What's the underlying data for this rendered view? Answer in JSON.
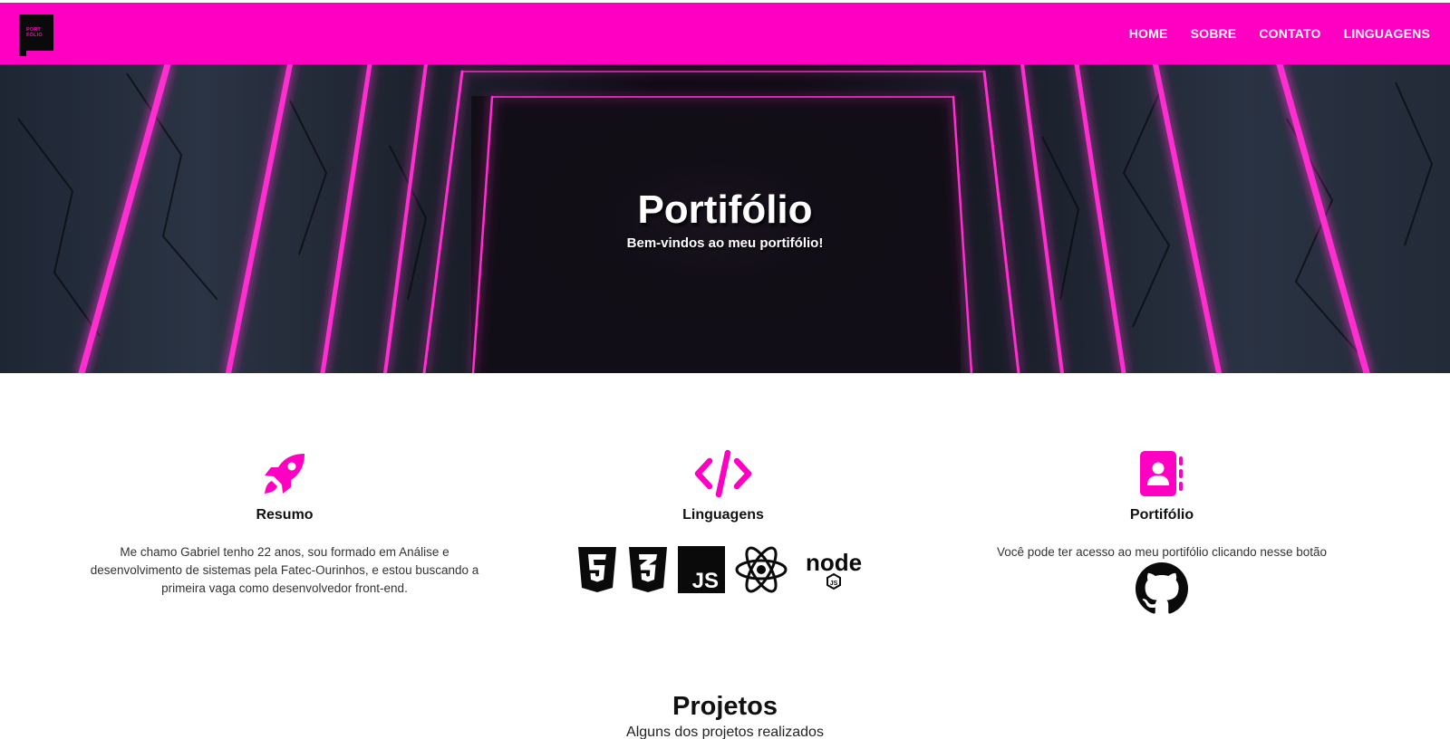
{
  "brand": {
    "logo_text": "PORT FÓLIO",
    "accent_color": "#ff00c3"
  },
  "nav": {
    "items": [
      "HOME",
      "SOBRE",
      "CONTATO",
      "LINGUAGENS"
    ]
  },
  "hero": {
    "title": "Portifólio",
    "subtitle": "Bem-vindos ao meu portifólio!"
  },
  "features": [
    {
      "icon": "rocket-icon",
      "title": "Resumo",
      "text": "Me chamo Gabriel tenho 22 anos, sou formado em Análise e desenvolvimento de sistemas pela Fatec-Ourinhos, e estou buscando a primeira vaga como desenvolvedor front-end."
    },
    {
      "icon": "code-icon",
      "title": "Linguagens",
      "languages": [
        "html5-icon",
        "css3-icon",
        "javascript-icon",
        "react-icon",
        "nodejs-icon"
      ]
    },
    {
      "icon": "address-book-icon",
      "title": "Portifólio",
      "text": "Você pode ter acesso ao meu portifólio clicando nesse botão",
      "link_icon": "github-icon"
    }
  ],
  "projects": {
    "title": "Projetos",
    "subtitle": "Alguns dos projetos realizados"
  }
}
